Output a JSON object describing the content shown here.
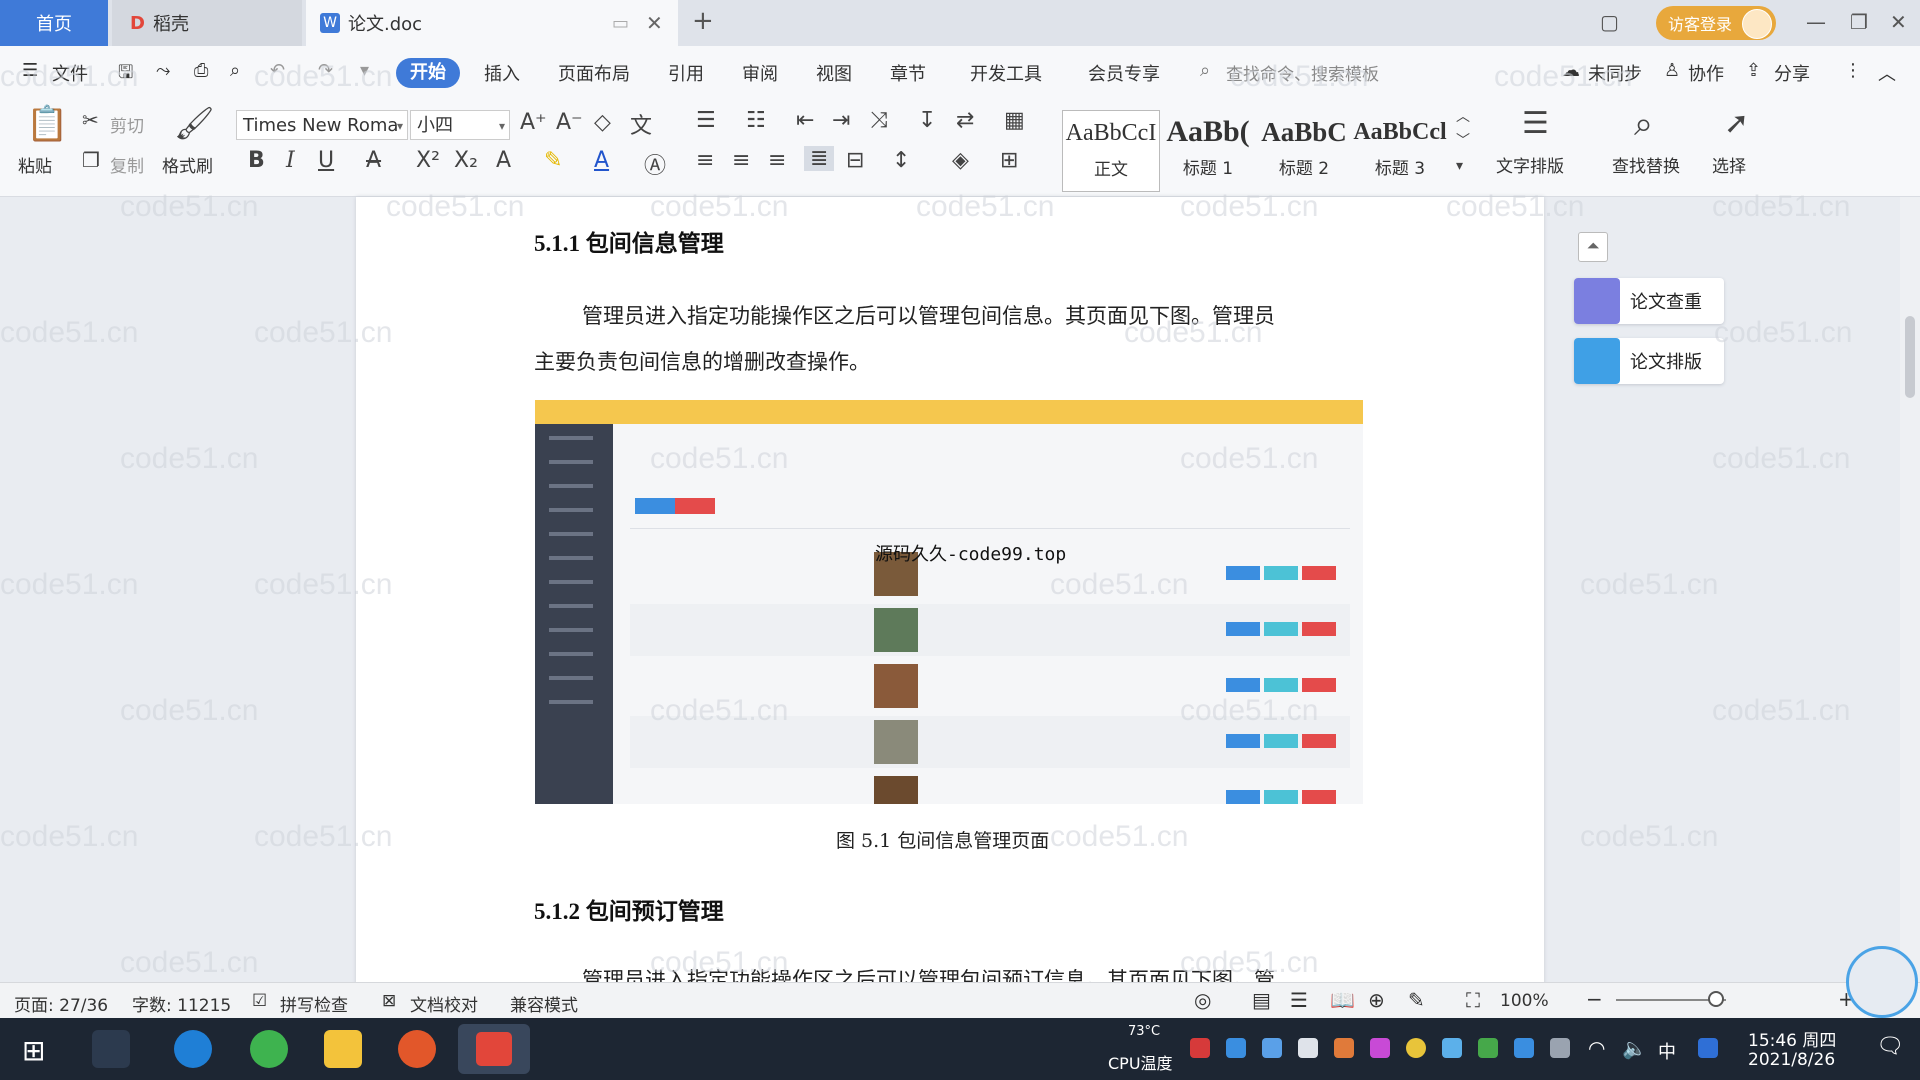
{
  "titlebar": {
    "tabs": [
      {
        "label": "首页"
      },
      {
        "label": "稻壳"
      },
      {
        "label": "论文.doc"
      }
    ],
    "new_tab": "+",
    "login": "访客登录"
  },
  "menubar": {
    "file": "文件",
    "items": [
      "开始",
      "插入",
      "页面布局",
      "引用",
      "审阅",
      "视图",
      "章节",
      "开发工具",
      "会员专享"
    ],
    "search_placeholder": "查找命令、搜索模板",
    "sync": "未同步",
    "collab": "协作",
    "share": "分享"
  },
  "ribbon": {
    "paste": "粘贴",
    "cut": "剪切",
    "copy": "复制",
    "format_painter": "格式刷",
    "font_name": "Times New Roma",
    "font_size": "小四",
    "styles": [
      {
        "sample": "AaBbCcI",
        "label": "正文"
      },
      {
        "sample": "AaBb(",
        "label": "标题 1"
      },
      {
        "sample": "AaBbC",
        "label": "标题 2"
      },
      {
        "sample": "AaBbCcl",
        "label": "标题 3"
      }
    ],
    "text_layout": "文字排版",
    "find_replace": "查找替换",
    "select": "选择"
  },
  "document": {
    "heading1": "5.1.1  包间信息管理",
    "para1_line1": "管理员进入指定功能操作区之后可以管理包间信息。其页面见下图。管理员",
    "para1_line2": "主要负责包间信息的增删改查操作。",
    "figure_overlay": "源码久久-code99.top",
    "caption": "图 5.1  包间信息管理页面",
    "heading2": "5.1.2  包间预订管理",
    "para2_partial": "管理员进入指定功能操作区之后可以管理包间预订信息。其页面见下图。管"
  },
  "side_tools": {
    "check": "论文查重",
    "layout": "论文排版"
  },
  "watermark": "code51.cn",
  "statusbar": {
    "page": "页面: 27/36",
    "words": "字数: 11215",
    "spell": "拼写检查",
    "proof": "文档校对",
    "compat": "兼容模式",
    "zoom": "100%"
  },
  "taskbar": {
    "cpu_temp": "73°C",
    "cpu_label": "CPU温度",
    "ime": "中",
    "time": "15:46 周四",
    "date": "2021/8/26"
  },
  "colors": {
    "accent": "#3f7ad8",
    "login": "#e8a83c",
    "figure_header": "#f5c74e",
    "figure_sidebar": "#3a4150"
  }
}
